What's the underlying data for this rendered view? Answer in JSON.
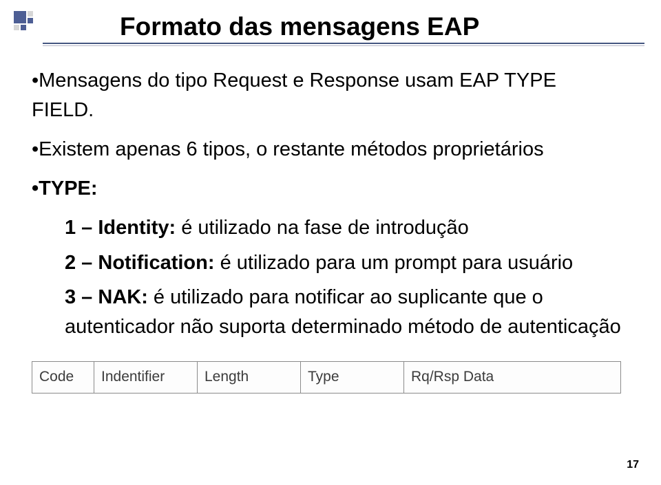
{
  "title": "Formato das mensagens EAP",
  "bullets": {
    "b1": "•Mensagens do tipo Request e Response usam EAP TYPE FIELD.",
    "b2": "•Existem apenas 6 tipos, o restante métodos proprietários",
    "b3_label": "•TYPE:",
    "types": {
      "t1_label": "1 – Identity:",
      "t1_text": " é utilizado na fase de introdução",
      "t2_label": "2 – Notification:",
      "t2_text": " é utilizado para um prompt para usuário",
      "t3_label": "3 – NAK:",
      "t3_text": " é utilizado para notificar ao suplicante que o autenticador não suporta determinado método de autenticação"
    }
  },
  "table": {
    "code": "Code",
    "identifier": "Indentifier",
    "length": "Length",
    "type": "Type",
    "data": "Rq/Rsp Data"
  },
  "pagenum": "17"
}
